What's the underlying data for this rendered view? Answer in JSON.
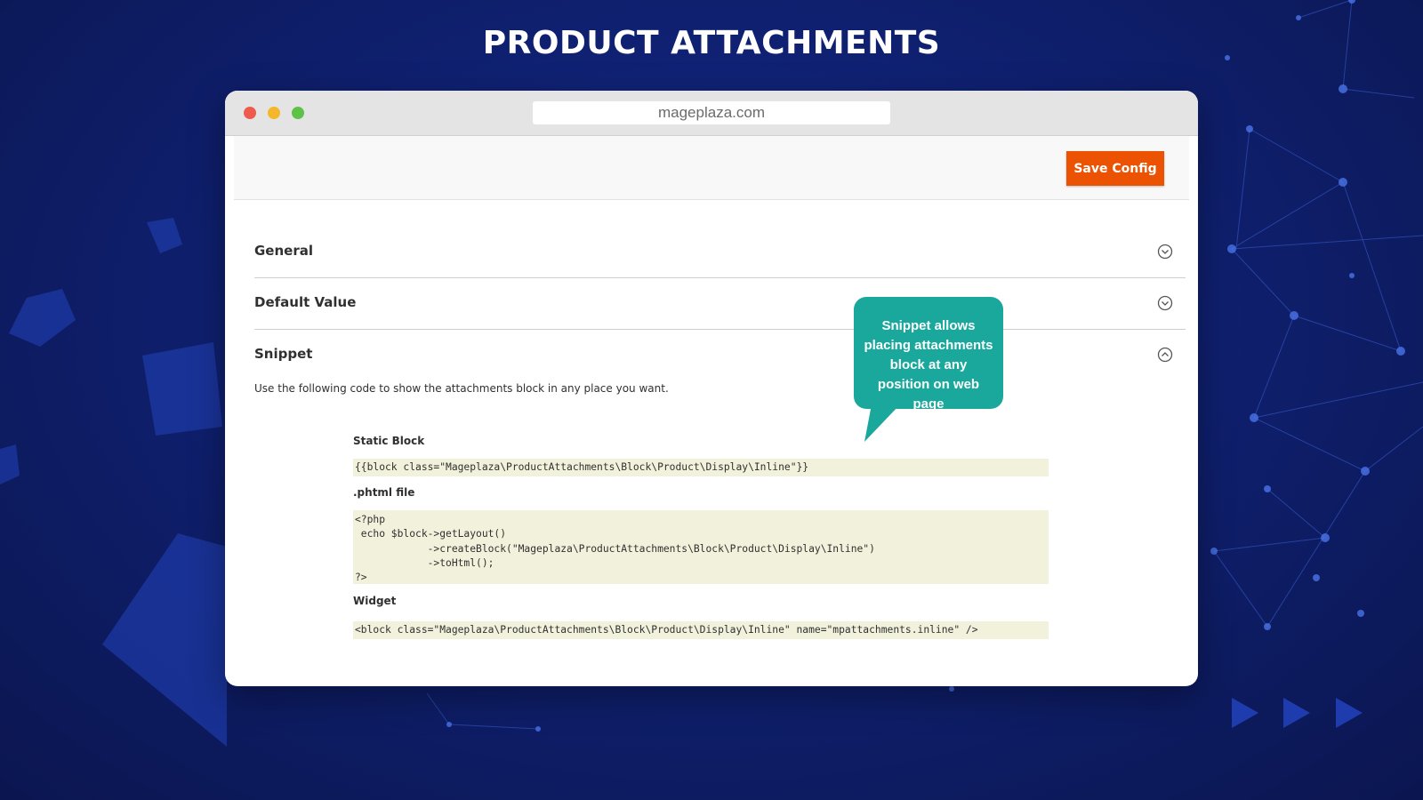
{
  "page": {
    "title": "PRODUCT ATTACHMENTS"
  },
  "browser": {
    "url": "mageplaza.com"
  },
  "toolbar": {
    "save_label": "Save Config"
  },
  "sections": [
    {
      "label": "General",
      "icon": "chevron-down-circle-icon",
      "expanded": false
    },
    {
      "label": "Default Value",
      "icon": "chevron-down-circle-icon",
      "expanded": false
    },
    {
      "label": "Snippet",
      "icon": "chevron-up-circle-icon",
      "expanded": true
    }
  ],
  "snippet": {
    "description": "Use the following code to show the attachments block in any place you want.",
    "static_block_label": "Static Block",
    "static_block_code": "{{block class=\"Mageplaza\\ProductAttachments\\Block\\Product\\Display\\Inline\"}}",
    "phtml_label": ".phtml file",
    "phtml_code": "<?php\n echo $block->getLayout()\n            ->createBlock(\"Mageplaza\\ProductAttachments\\Block\\Product\\Display\\Inline\")\n            ->toHtml();\n?>",
    "widget_label": "Widget",
    "widget_code": "<block class=\"Mageplaza\\ProductAttachments\\Block\\Product\\Display\\Inline\" name=\"mpattachments.inline\" />"
  },
  "tooltip": {
    "text": "Snippet allows placing attachments block at any position on web page"
  },
  "colors": {
    "background": "#0f2070",
    "save_button": "#eb5202",
    "tooltip": "#1aa89d",
    "code_background": "#f2f2dc"
  }
}
